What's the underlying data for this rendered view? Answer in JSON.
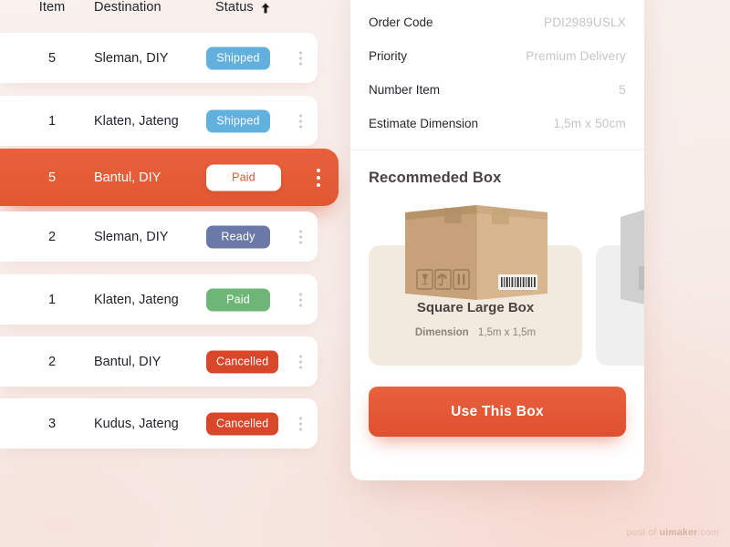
{
  "table": {
    "columns": [
      {
        "key": "item",
        "label": "Item"
      },
      {
        "key": "destination",
        "label": "Destination"
      },
      {
        "key": "status",
        "label": "Status"
      }
    ],
    "sort": {
      "column": "Status",
      "direction": "asc",
      "icon": "arrow-up-icon"
    },
    "row_menu_icon": "kebab-menu-icon",
    "rows": [
      {
        "item": "5",
        "destination": "Sleman, DIY",
        "status": "Shipped",
        "status_kind": "shipped",
        "active": false
      },
      {
        "item": "1",
        "destination": "Klaten, Jateng",
        "status": "Shipped",
        "status_kind": "shipped",
        "active": false
      },
      {
        "item": "5",
        "destination": "Bantul, DIY",
        "status": "Paid",
        "status_kind": "paid-on-active",
        "active": true
      },
      {
        "item": "2",
        "destination": "Sleman, DIY",
        "status": "Ready",
        "status_kind": "ready",
        "active": false
      },
      {
        "item": "1",
        "destination": "Klaten, Jateng",
        "status": "Paid",
        "status_kind": "paid",
        "active": false
      },
      {
        "item": "2",
        "destination": "Bantul, DIY",
        "status": "Cancelled",
        "status_kind": "cancelled",
        "active": false
      },
      {
        "item": "3",
        "destination": "Kudus, Jateng",
        "status": "Cancelled",
        "status_kind": "cancelled",
        "active": false
      }
    ]
  },
  "detail": {
    "summary": [
      {
        "label": "Order Code",
        "value": "PDI2989USLX"
      },
      {
        "label": "Priority",
        "value": "Premium Delivery"
      },
      {
        "label": "Number Item",
        "value": "5"
      },
      {
        "label": "Estimate Dimension",
        "value": "1,5m x 50cm"
      }
    ],
    "recommended": {
      "title": "Recommeded Box",
      "selected_box": {
        "name": "Square Large Box",
        "dimension_label": "Dimension",
        "dimension_value": "1,5m x 1,5m",
        "illustration": "cardboard-box-illustration",
        "handling_symbols": [
          "fragile-glass-icon",
          "keep-dry-umbrella-icon",
          "this-side-up-icon"
        ],
        "barcode": "barcode-label"
      },
      "next_box": {
        "illustration": "grey-box-illustration"
      }
    },
    "use_box_button": "Use This Box"
  },
  "watermark": {
    "prefix": "post of ",
    "brand": "uimaker",
    "suffix": ".com"
  },
  "colors": {
    "accent": "#e2542f",
    "shipped": "#62b0de",
    "ready": "#6a79a8",
    "paid": "#6eb677",
    "cancelled": "#d9472b",
    "panel": "#ffffff",
    "background": "#f7ebe7"
  }
}
